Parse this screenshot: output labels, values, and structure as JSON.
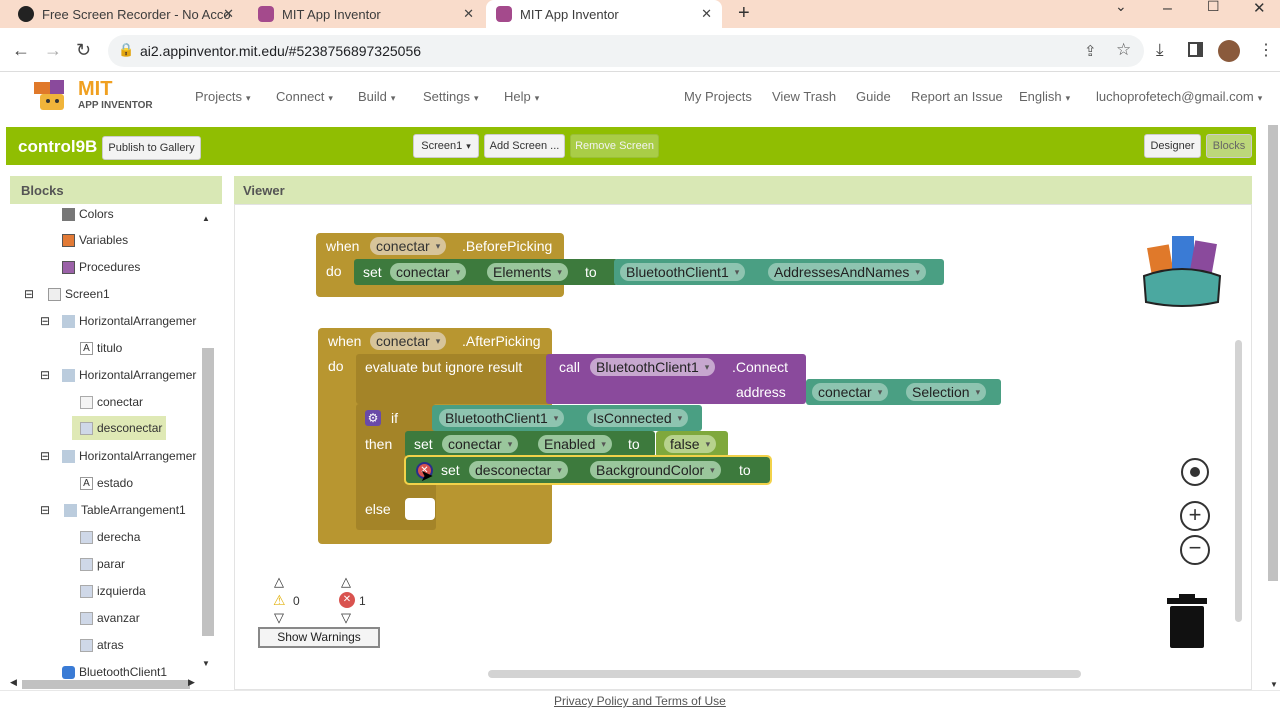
{
  "browser": {
    "tabs": [
      {
        "title": "Free Screen Recorder - No Acco"
      },
      {
        "title": "MIT App Inventor"
      },
      {
        "title": "MIT App Inventor"
      }
    ],
    "url": "ai2.appinventor.mit.edu/#5238756897325056"
  },
  "app": {
    "logo_top": "MIT",
    "logo_bottom": "APP INVENTOR",
    "menus": [
      "Projects",
      "Connect",
      "Build",
      "Settings",
      "Help"
    ],
    "right_links": [
      "My Projects",
      "View Trash",
      "Guide",
      "Report an Issue",
      "English",
      "luchoprofetech@gmail.com"
    ]
  },
  "toolbar": {
    "project_name": "control9B",
    "publish_label": "Publish to Gallery",
    "screen_select": "Screen1",
    "add_screen": "Add Screen ...",
    "remove_screen": "Remove Screen",
    "designer": "Designer",
    "blocks": "Blocks"
  },
  "blocks_panel": {
    "title": "Blocks",
    "items": [
      {
        "label": "Colors"
      },
      {
        "label": "Variables"
      },
      {
        "label": "Procedures"
      },
      {
        "label": "Screen1"
      },
      {
        "label": "HorizontalArrangemer"
      },
      {
        "label": "titulo"
      },
      {
        "label": "HorizontalArrangemer"
      },
      {
        "label": "conectar"
      },
      {
        "label": "desconectar"
      },
      {
        "label": "HorizontalArrangemer"
      },
      {
        "label": "estado"
      },
      {
        "label": "TableArrangement1"
      },
      {
        "label": "derecha"
      },
      {
        "label": "parar"
      },
      {
        "label": "izquierda"
      },
      {
        "label": "avanzar"
      },
      {
        "label": "atras"
      },
      {
        "label": "BluetoothClient1"
      }
    ]
  },
  "viewer": {
    "title": "Viewer",
    "block1": {
      "when": "when",
      "component": "conectar",
      "event": ".BeforePicking",
      "do": "do",
      "set": "set",
      "set_comp": "conectar",
      "set_prop": "Elements",
      "to": "to",
      "val_comp": "BluetoothClient1",
      "val_prop": "AddressesAndNames"
    },
    "block2": {
      "when": "when",
      "component": "conectar",
      "event": ".AfterPicking",
      "do": "do",
      "evaluate": "evaluate but ignore result",
      "call": "call",
      "call_comp": "BluetoothClient1",
      "call_method": ".Connect",
      "address": "address",
      "addr_comp": "conectar",
      "addr_prop": "Selection",
      "if": "if",
      "if_comp": "BluetoothClient1",
      "if_prop": "IsConnected",
      "then": "then",
      "set": "set",
      "then_comp": "conectar",
      "then_prop": "Enabled",
      "to": "to",
      "false": "false",
      "set2_comp": "desconectar",
      "set2_prop": "BackgroundColor",
      "else": "else"
    },
    "warnings_count": "0",
    "errors_count": "1",
    "show_warnings": "Show Warnings"
  },
  "footer": {
    "text": "Privacy Policy and Terms of Use"
  }
}
